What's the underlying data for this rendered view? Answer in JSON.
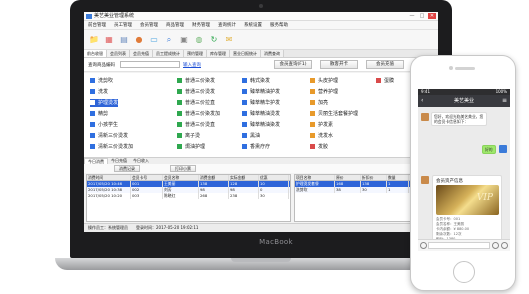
{
  "laptop": {
    "brand": "MacBook",
    "app": {
      "title": "美艺美业管理系统",
      "win_buttons": [
        "—",
        "□",
        "✕"
      ],
      "menus": [
        "前台管理",
        "员工管理",
        "会员管理",
        "商品管理",
        "财务管理",
        "查询统计",
        "系统设置",
        "服务帮助"
      ],
      "toolbar_icons": [
        "folder-icon",
        "calendar-icon",
        "document-icon",
        "user-icon",
        "id-card-icon",
        "search-icon",
        "printer-icon",
        "user-group-icon",
        "refresh-icon",
        "mail-icon"
      ],
      "tabs": [
        "前台收银",
        "会员列表",
        "会员充值",
        "员工提成统计",
        "预约管理",
        "库存管理",
        "营业日报统计",
        "消费查询"
      ],
      "search": {
        "label": "查询商品编码",
        "placeholder": "",
        "link": "输入查询",
        "buttons": [
          "会员查询(F1)",
          "散客开卡",
          "会员充值",
          "刷卡"
        ]
      },
      "services": [
        {
          "label": "洗剪吹",
          "color": "#2f6fe0",
          "selected": false
        },
        {
          "label": "洗发",
          "color": "#2f6fe0",
          "selected": false
        },
        {
          "label": "护理烫发",
          "color": "#2f6fe0",
          "selected": true
        },
        {
          "label": "精剪",
          "color": "#2f6fe0",
          "selected": false
        },
        {
          "label": "小孩学生",
          "color": "#2f6fe0",
          "selected": false
        },
        {
          "label": "清新三价烫发",
          "color": "#2f6fe0",
          "selected": false
        },
        {
          "label": "清新三价烫发加",
          "color": "#2f6fe0",
          "selected": false
        },
        {
          "label": "普通三价染发",
          "color": "#2fa84f",
          "selected": false
        },
        {
          "label": "普通三价烫发",
          "color": "#2fa84f",
          "selected": false
        },
        {
          "label": "普通三价拉直",
          "color": "#2fa84f",
          "selected": false
        },
        {
          "label": "普通三价染发加",
          "color": "#2fa84f",
          "selected": false
        },
        {
          "label": "普通三价烫直",
          "color": "#2fa84f",
          "selected": false
        },
        {
          "label": "离子烫",
          "color": "#2fa84f",
          "selected": false
        },
        {
          "label": "焗油护理",
          "color": "#2fa84f",
          "selected": false
        },
        {
          "label": "韩式染发",
          "color": "#2f6fe0",
          "selected": false
        },
        {
          "label": "臻萃精油护发",
          "color": "#2f6fe0",
          "selected": false
        },
        {
          "label": "臻萃精华护发",
          "color": "#2f6fe0",
          "selected": false
        },
        {
          "label": "臻萃精油烫发",
          "color": "#2f6fe0",
          "selected": false
        },
        {
          "label": "臻萃精油染发",
          "color": "#2f6fe0",
          "selected": false
        },
        {
          "label": "黑油",
          "color": "#2f6fe0",
          "selected": false
        },
        {
          "label": "香熏疗疗",
          "color": "#2f6fe0",
          "selected": false
        },
        {
          "label": "头皮护理",
          "color": "#e89a2b",
          "selected": false
        },
        {
          "label": "营养护理",
          "color": "#e89a2b",
          "selected": false
        },
        {
          "label": "加亮",
          "color": "#e89a2b",
          "selected": false
        },
        {
          "label": "贝丽生活套餐护理",
          "color": "#e89a2b",
          "selected": false
        },
        {
          "label": "护发素",
          "color": "#e89a2b",
          "selected": false
        },
        {
          "label": "洗发水",
          "color": "#e89a2b",
          "selected": false
        },
        {
          "label": "发胶",
          "color": "#d94a4a",
          "selected": false
        },
        {
          "label": "蛋膜",
          "color": "#d94a4a",
          "selected": false
        }
      ],
      "bottom_tabs": [
        "今日消费",
        "今日充值",
        "今日收入"
      ],
      "bottom_buttons": [
        "消费记录",
        "打印小票"
      ],
      "left_table": {
        "headers": [
          "消费时间",
          "会员卡号",
          "会员名称",
          "消费金额",
          "实际金额",
          "优惠"
        ],
        "rows": [
          [
            "2017/05/20 10:46",
            "001",
            "王美丽",
            "138",
            "128",
            "10"
          ],
          [
            "2017/05/20 10:38",
            "002",
            "刘芳",
            "98",
            "98",
            "0"
          ],
          [
            "2017/05/20 10:20",
            "003",
            "陈晓红",
            "268",
            "238",
            "30"
          ]
        ]
      },
      "right_table": {
        "headers": [
          "项目名称",
          "原价",
          "折扣价",
          "数量",
          "金额"
        ],
        "rows": [
          [
            "护理烫发套餐",
            "168",
            "138",
            "1",
            "138"
          ],
          [
            "洗剪吹",
            "38",
            "30",
            "1",
            "30"
          ]
        ]
      },
      "status": "操作员工：系统管理员　　登录时间：2017-05-20 19:02:11"
    }
  },
  "phone": {
    "status_time": "9:41",
    "status_right": "100%",
    "chat_title": "美艺美业",
    "back_label": "‹",
    "menu_label": "≡",
    "message_text": "您好，欢迎光临美艺美业，您的会员卡信息如下：",
    "reply_text": "好的",
    "card_title": "会员资产信息",
    "vip_label": "VIP",
    "card_lines": [
      "会员卡号：001",
      "会员名称：王美丽",
      "卡内余额：¥ 880.00",
      "剩余次数：12次",
      "积分：1380"
    ],
    "input_placeholder": ""
  }
}
